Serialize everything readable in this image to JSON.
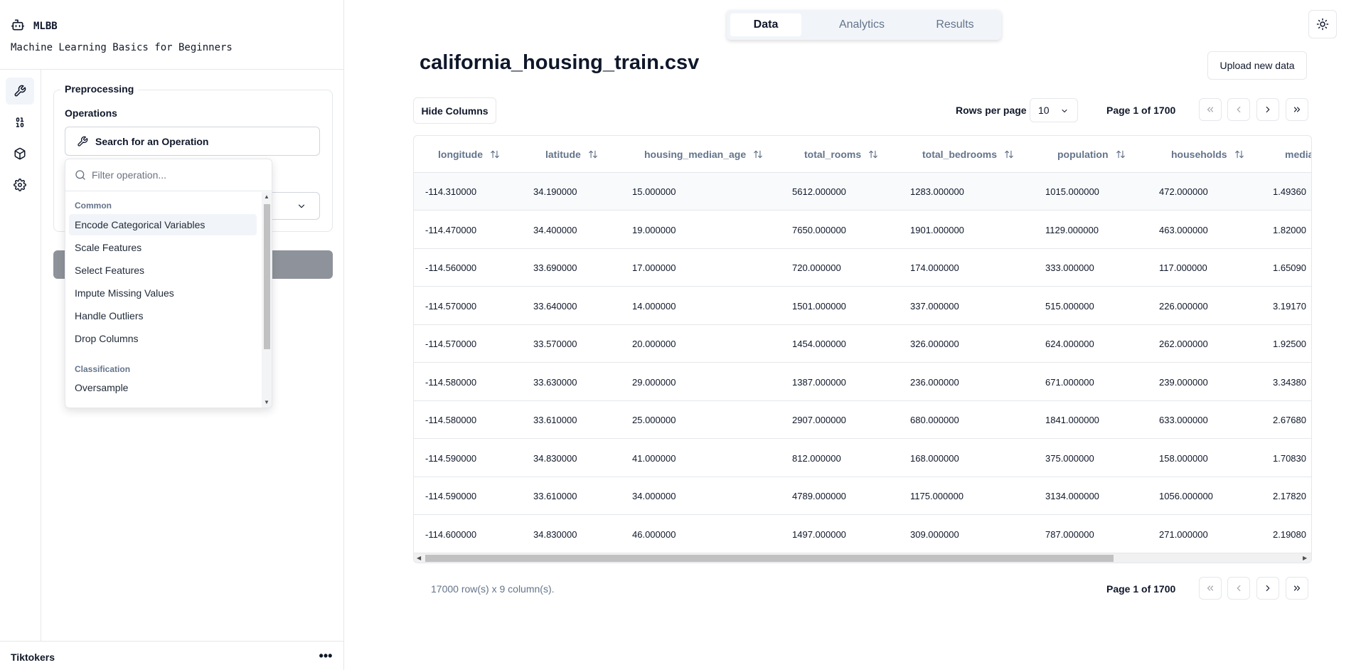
{
  "app": {
    "name": "MLBB",
    "subtitle": "Machine Learning Basics for Beginners"
  },
  "rail": [
    "wrench-icon",
    "binary-icon",
    "box-icon",
    "settings-icon"
  ],
  "preprocessing": {
    "legend": "Preprocessing",
    "operations_label": "Operations",
    "search_label": "Search for an Operation",
    "filter_placeholder": "Filter operation...",
    "groups": [
      {
        "name": "Common",
        "items": [
          "Encode Categorical Variables",
          "Scale Features",
          "Select Features",
          "Impute Missing Values",
          "Handle Outliers",
          "Drop Columns"
        ]
      },
      {
        "name": "Classification",
        "items": [
          "Oversample"
        ]
      }
    ]
  },
  "footer": {
    "user": "Tiktokers",
    "more": "•••"
  },
  "tabs": [
    "Data",
    "Analytics",
    "Results"
  ],
  "active_tab": "Data",
  "main": {
    "file_title": "california_housing_train.csv",
    "upload_label": "Upload new data",
    "hide_columns_label": "Hide Columns",
    "rows_per_page_label": "Rows per page",
    "rows_per_page_value": "10",
    "page_info": "Page 1 of 1700",
    "row_count": "17000 row(s) x 9 column(s)."
  },
  "table": {
    "columns": [
      "longitude",
      "latitude",
      "housing_median_age",
      "total_rooms",
      "total_bedrooms",
      "population",
      "households",
      "media"
    ],
    "rows": [
      [
        "-114.310000",
        "34.190000",
        "15.000000",
        "5612.000000",
        "1283.000000",
        "1015.000000",
        "472.000000",
        "1.49360"
      ],
      [
        "-114.470000",
        "34.400000",
        "19.000000",
        "7650.000000",
        "1901.000000",
        "1129.000000",
        "463.000000",
        "1.82000"
      ],
      [
        "-114.560000",
        "33.690000",
        "17.000000",
        "720.000000",
        "174.000000",
        "333.000000",
        "117.000000",
        "1.65090"
      ],
      [
        "-114.570000",
        "33.640000",
        "14.000000",
        "1501.000000",
        "337.000000",
        "515.000000",
        "226.000000",
        "3.19170"
      ],
      [
        "-114.570000",
        "33.570000",
        "20.000000",
        "1454.000000",
        "326.000000",
        "624.000000",
        "262.000000",
        "1.92500"
      ],
      [
        "-114.580000",
        "33.630000",
        "29.000000",
        "1387.000000",
        "236.000000",
        "671.000000",
        "239.000000",
        "3.34380"
      ],
      [
        "-114.580000",
        "33.610000",
        "25.000000",
        "2907.000000",
        "680.000000",
        "1841.000000",
        "633.000000",
        "2.67680"
      ],
      [
        "-114.590000",
        "34.830000",
        "41.000000",
        "812.000000",
        "168.000000",
        "375.000000",
        "158.000000",
        "1.70830"
      ],
      [
        "-114.590000",
        "33.610000",
        "34.000000",
        "4789.000000",
        "1175.000000",
        "3134.000000",
        "1056.000000",
        "2.17820"
      ],
      [
        "-114.600000",
        "34.830000",
        "46.000000",
        "1497.000000",
        "309.000000",
        "787.000000",
        "271.000000",
        "2.19080"
      ]
    ]
  },
  "colors": {
    "accent": "#0f172a",
    "muted": "#64748b",
    "border": "#e5e7eb",
    "highlight": "#f1f5f9"
  }
}
